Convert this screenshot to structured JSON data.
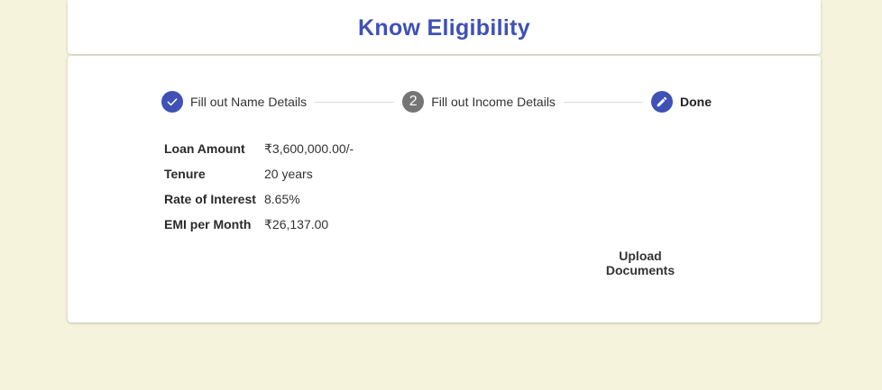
{
  "header": {
    "title": "Know Eligibility"
  },
  "stepper": {
    "steps": [
      {
        "label": "Fill out Name Details",
        "state": "completed",
        "icon": "check-icon"
      },
      {
        "label": "Fill out Income Details",
        "state": "pending",
        "number": "2"
      },
      {
        "label": "Done",
        "state": "active",
        "icon": "pencil-icon"
      }
    ]
  },
  "details": {
    "rows": [
      {
        "label": "Loan Amount",
        "value": "₹3,600,000.00/-"
      },
      {
        "label": "Tenure",
        "value": "20 years"
      },
      {
        "label": "Rate of Interest",
        "value": "8.65%"
      },
      {
        "label": "EMI per Month",
        "value": "₹26,137.00"
      }
    ]
  },
  "actions": {
    "upload_label": "Upload Documents"
  },
  "colors": {
    "accent": "#3f51b5",
    "step_pending": "#757575",
    "background": "#f5f3dc"
  }
}
